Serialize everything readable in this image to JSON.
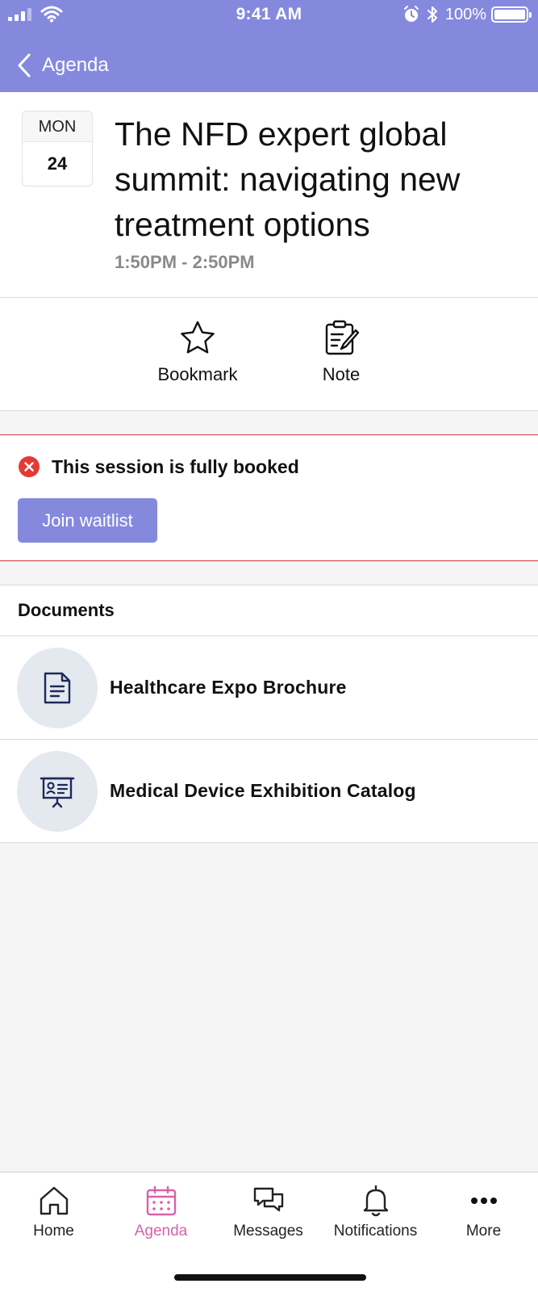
{
  "status_bar": {
    "time": "9:41 AM",
    "battery_text": "100%",
    "battery_level": 1.0,
    "icons": [
      "signal-icon",
      "wifi-icon",
      "alarm-icon",
      "bluetooth-icon",
      "battery-icon"
    ]
  },
  "nav": {
    "back_label": "Agenda",
    "back_icon": "chevron-left-icon"
  },
  "session": {
    "date": {
      "weekday": "MON",
      "day": "24"
    },
    "title": "The NFD expert global summit: navigating new treatment options",
    "time_range": "1:50PM - 2:50PM"
  },
  "actions": [
    {
      "label": "Bookmark",
      "icon": "star-icon"
    },
    {
      "label": "Note",
      "icon": "note-icon"
    }
  ],
  "booking": {
    "message": "This session is fully booked",
    "status_icon": "error-icon",
    "button_label": "Join waitlist"
  },
  "documents": {
    "header": "Documents",
    "items": [
      {
        "title": "Healthcare Expo Brochure",
        "icon": "document-icon"
      },
      {
        "title": "Medical Device Exhibition Catalog",
        "icon": "presentation-icon"
      }
    ]
  },
  "tabbar": {
    "items": [
      {
        "label": "Home",
        "icon": "home-icon",
        "active": false
      },
      {
        "label": "Agenda",
        "icon": "calendar-icon",
        "active": true
      },
      {
        "label": "Messages",
        "icon": "messages-icon",
        "active": false
      },
      {
        "label": "Notifications",
        "icon": "bell-icon",
        "active": false
      },
      {
        "label": "More",
        "icon": "more-icon",
        "active": false
      }
    ]
  },
  "colors": {
    "brand": "#8589de",
    "active_tab": "#d861a9",
    "error": "#e53935",
    "doc_icon": "#1d2a5a"
  }
}
